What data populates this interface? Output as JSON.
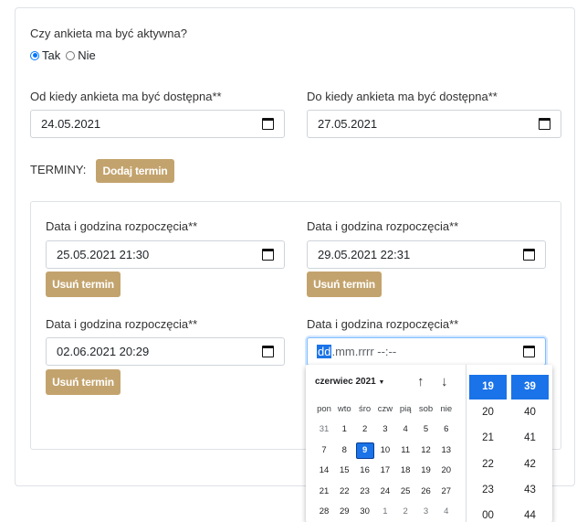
{
  "active_question": {
    "label": "Czy ankieta ma być aktywna?",
    "options": [
      {
        "label": "Tak",
        "checked": true
      },
      {
        "label": "Nie",
        "checked": false
      }
    ]
  },
  "availability": {
    "from_label": "Od kiedy ankieta ma być dostępna**",
    "from_value": "24.05.2021",
    "to_label": "Do kiedy ankieta ma być dostępna**",
    "to_value": "27.05.2021"
  },
  "terms": {
    "label": "TERMINY:",
    "add_button": "Dodaj termin",
    "items": [
      {
        "label": "Data i godzina rozpoczęcia**",
        "value": "25.05.2021 21:30",
        "remove": "Usuń termin"
      },
      {
        "label": "Data i godzina rozpoczęcia**",
        "value": "29.05.2021 22:31",
        "remove": "Usuń termin"
      },
      {
        "label": "Data i godzina rozpoczęcia**",
        "value": "02.06.2021 20:29",
        "remove": "Usuń termin"
      },
      {
        "label": "Data i godzina rozpoczęcia**",
        "seg_day": "dd",
        "seg_rest": ".mm.rrrr --:--"
      }
    ]
  },
  "picker": {
    "month": "czerwiec 2021",
    "weekdays": [
      "pon",
      "wto",
      "śro",
      "czw",
      "pią",
      "sob",
      "nie"
    ],
    "weeks": [
      [
        "31",
        "1",
        "2",
        "3",
        "4",
        "5",
        "6"
      ],
      [
        "7",
        "8",
        "9",
        "10",
        "11",
        "12",
        "13"
      ],
      [
        "14",
        "15",
        "16",
        "17",
        "18",
        "19",
        "20"
      ],
      [
        "21",
        "22",
        "23",
        "24",
        "25",
        "26",
        "27"
      ],
      [
        "28",
        "29",
        "30",
        "1",
        "2",
        "3",
        "4"
      ]
    ],
    "selected_day": "9",
    "hours": [
      "19",
      "20",
      "21",
      "22",
      "23",
      "00"
    ],
    "minutes": [
      "39",
      "40",
      "41",
      "42",
      "43",
      "44"
    ],
    "selected_hour": "19",
    "selected_minute": "39"
  },
  "icons": {
    "calendar": "calendar-icon",
    "arrow_up": "arrow-up-icon",
    "arrow_down": "arrow-down-icon",
    "dropdown": "caret-down-icon"
  },
  "colors": {
    "accent_gold": "#c3a36d",
    "selection_blue": "#1a73e8",
    "radio_blue": "#0075ff"
  }
}
